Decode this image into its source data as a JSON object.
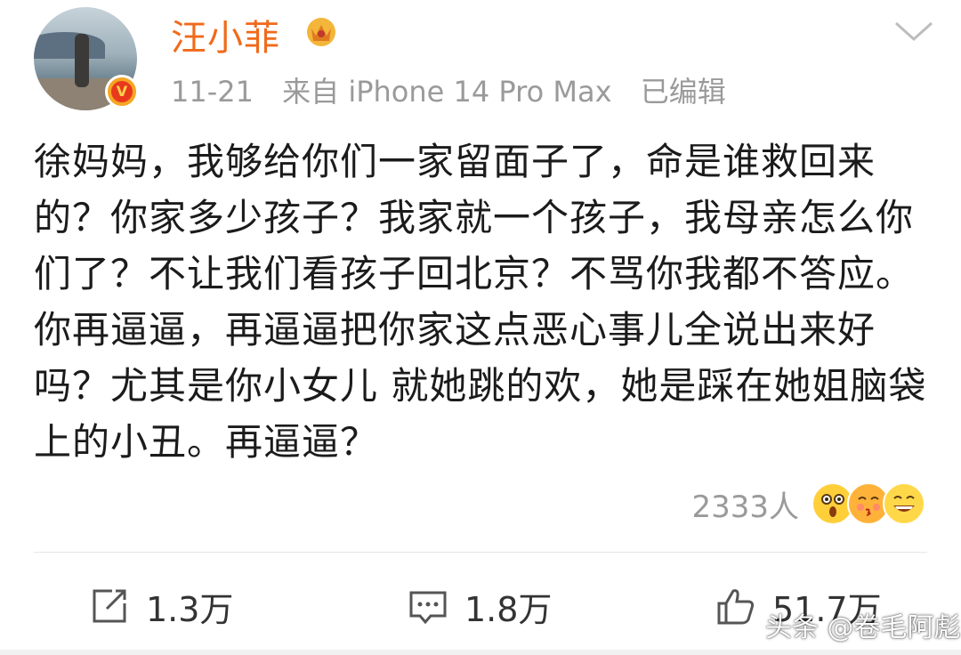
{
  "author": {
    "name": "汪小菲",
    "verified_badge": "v-verified-icon",
    "member_badge": "crown-icon"
  },
  "meta": {
    "date": "11-21",
    "source": "来自 iPhone 14 Pro Max",
    "edited": "已编辑"
  },
  "post": {
    "text": "徐妈妈，我够给你们一家留面子了，命是谁救回来的？你家多少孩子？我家就一个孩子，我母亲怎么你们了？不让我们看孩子回北京？不骂你我都不答应。你再逼逼，再逼逼把你家这点恶心事儿全说出来好吗？尤其是你小女儿 就她跳的欢，她是踩在她姐脑袋上的小丑。再逼逼？"
  },
  "reactions": {
    "count": "2333人",
    "emojis": [
      "shocked-emoji",
      "kiss-emoji",
      "grin-emoji"
    ]
  },
  "actions": {
    "repost": "1.3万",
    "comment": "1.8万",
    "like": "51.7万"
  },
  "watermark": "头条 @卷毛阿彪",
  "colors": {
    "username": "#f06a1b",
    "meta": "#9a9a9a",
    "text": "#1b1b1b"
  }
}
